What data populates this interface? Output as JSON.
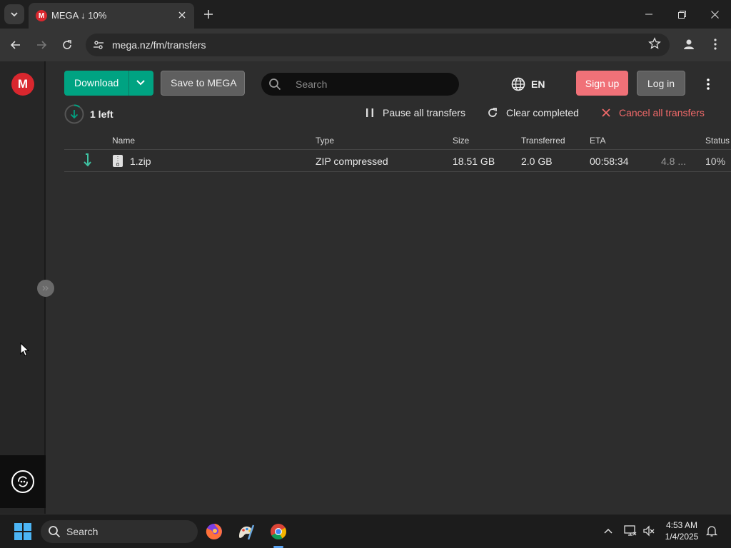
{
  "browser": {
    "tab_title": "MEGA ↓ 10%",
    "tab_favicon_letter": "M",
    "url": "mega.nz/fm/transfers",
    "icons": [
      "chevron-down-icon",
      "close-icon",
      "plus-icon",
      "minimize-icon",
      "restore-icon",
      "back-icon",
      "forward-icon",
      "reload-icon",
      "site-settings-icon",
      "star-icon",
      "profile-icon",
      "kebab-menu-icon"
    ]
  },
  "sidebar": {
    "logo_letter": "M",
    "icons": [
      "mega-logo-icon",
      "collapse-handle-icon",
      "sync-icon"
    ]
  },
  "header": {
    "download_label": "Download",
    "save_label": "Save to MEGA",
    "search_placeholder": "Search",
    "language": "EN",
    "signup_label": "Sign up",
    "login_label": "Log in"
  },
  "transfers": {
    "left_count": "1 left",
    "progress_fraction": 0.1,
    "actions": {
      "pause": "Pause all transfers",
      "clear": "Clear completed",
      "cancel": "Cancel all transfers"
    },
    "columns": {
      "name": "Name",
      "type": "Type",
      "size": "Size",
      "transferred": "Transferred",
      "eta": "ETA",
      "status": "Status"
    },
    "rows": [
      {
        "name": "1.zip",
        "type": "ZIP compressed",
        "size": "18.51 GB",
        "transferred": "2.0 GB",
        "eta": "00:58:34",
        "speed": "4.8 ...",
        "status": "10%"
      }
    ]
  },
  "colors": {
    "accent_green": "#00a382",
    "signup_red": "#f07178",
    "cancel_red": "#f26a6a",
    "mega_red": "#d9272e"
  },
  "taskbar": {
    "search_label": "Search",
    "time": "4:53 AM",
    "date": "1/4/2025",
    "apps": [
      "firefox-icon",
      "paint-icon",
      "chrome-icon"
    ]
  }
}
